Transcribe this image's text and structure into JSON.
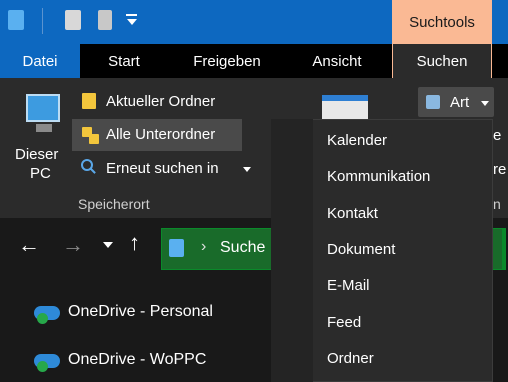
{
  "titlebar": {
    "context_tab": "Suchtools"
  },
  "tabs": [
    "Datei",
    "Start",
    "Freigeben",
    "Ansicht",
    "Suchen"
  ],
  "ribbon": {
    "dieser_pc_line1": "Dieser",
    "dieser_pc_line2": "PC",
    "aktueller_ordner": "Aktueller Ordner",
    "alle_unterordner": "Alle Unterordner",
    "erneut_suchen": "Erneut suchen in",
    "group_label": "Speicherort",
    "art_button": "Art",
    "partial_right_1": "e",
    "partial_right_2": "re",
    "partial_right_3": "n"
  },
  "navbar": {
    "address_text": "Suche"
  },
  "tree": [
    {
      "label": "OneDrive - Personal"
    },
    {
      "label": "OneDrive - WoPPC"
    }
  ],
  "menu": {
    "items": [
      "Kalender",
      "Kommunikation",
      "Kontakt",
      "Dokument",
      "E-Mail",
      "Feed",
      "Ordner"
    ]
  },
  "colors": {
    "accent": "#0d68c0",
    "context": "#fab994",
    "address": "#196b2a"
  }
}
